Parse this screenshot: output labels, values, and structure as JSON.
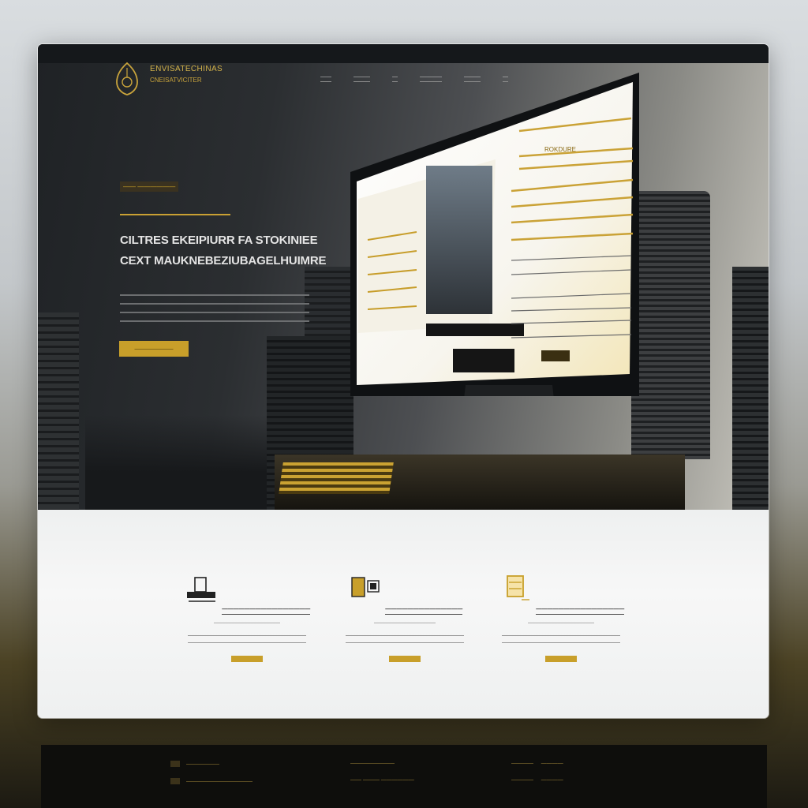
{
  "brand": {
    "name": "ENVISATECHINAS",
    "tagline": "CNEISATVICITER"
  },
  "nav": {
    "items": [
      "——",
      "———",
      "—",
      "————",
      "———",
      "—"
    ]
  },
  "hero": {
    "eyebrow": "—— ——————",
    "headline_line1": "CILTRES EKEIPIURR FA STOKINIEE",
    "headline_line2": "CEXT MAUKNEBEZIUBAGELHUIMRE",
    "cta_label": "———————"
  },
  "screen": {
    "title": "ROKDURE",
    "button1": "————————",
    "button2": "————"
  },
  "features": [
    {
      "icon": "building-icon",
      "title": "————————————————",
      "subtitle": "——————————————"
    },
    {
      "icon": "document-icon",
      "title": "——————————————",
      "subtitle": "—————————————"
    },
    {
      "icon": "box-icon",
      "title": "————————————————",
      "subtitle": "——————————————"
    }
  ],
  "colors": {
    "accent": "#c89f2a",
    "dark": "#15181b",
    "light": "#f2f3f3"
  }
}
